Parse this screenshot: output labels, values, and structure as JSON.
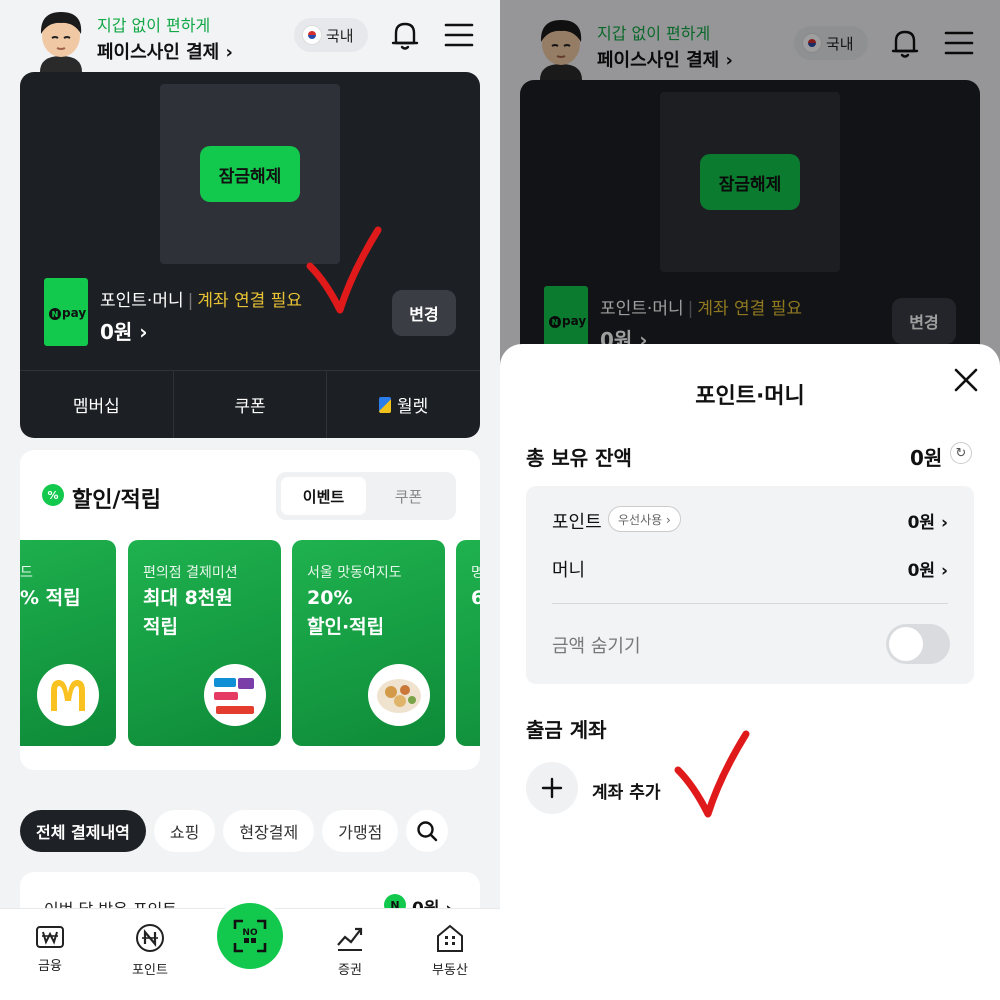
{
  "header": {
    "subtitle": "지갑 없이 편하게",
    "title": "페이스사인 결제 ›",
    "region_label": "국내"
  },
  "card": {
    "unlock_label": "잠금해제",
    "npay_logo": "pay",
    "points_money_label": "포인트·머니",
    "separator": "|",
    "account_warning": "계좌 연결 필요",
    "amount": "0원 ›",
    "change_label": "변경",
    "tabs": [
      "멤버십",
      "쿠폰",
      "월렛"
    ]
  },
  "discount": {
    "title": "할인/적립",
    "icon_text": "%",
    "segments": [
      "이벤트",
      "쿠폰"
    ],
    "promos": [
      {
        "sub": "드",
        "main": "% 적립"
      },
      {
        "sub": "편의점 결제미션",
        "main": "최대 8천원\n적립"
      },
      {
        "sub": "서울 맛동여지도",
        "main": "20%\n할인·적립"
      },
      {
        "sub": "명",
        "main": "6"
      }
    ]
  },
  "filters": [
    "전체 결제내역",
    "쇼핑",
    "현장결제",
    "가맹점"
  ],
  "points_row": {
    "label": "이번 달 받은 포인트",
    "value": "0원 ›"
  },
  "bottom_nav": [
    "금융",
    "포인트",
    "증권",
    "부동산"
  ],
  "sheet": {
    "title": "포인트·머니",
    "total_label": "총 보유 잔액",
    "total_value": "0원",
    "point_label": "포인트",
    "point_tag": "우선사용 ›",
    "point_value": "0원 ›",
    "money_label": "머니",
    "money_value": "0원 ›",
    "hide_label": "금액 숨기기",
    "hide_amount_on": false,
    "withdraw_label": "출금 계좌",
    "add_account_label": "계좌 추가"
  },
  "colors": {
    "brand_green": "#12c84d",
    "card_dark": "#1c1f24",
    "warning_yellow": "#e7c234",
    "annotation_red": "#e01a1a"
  }
}
